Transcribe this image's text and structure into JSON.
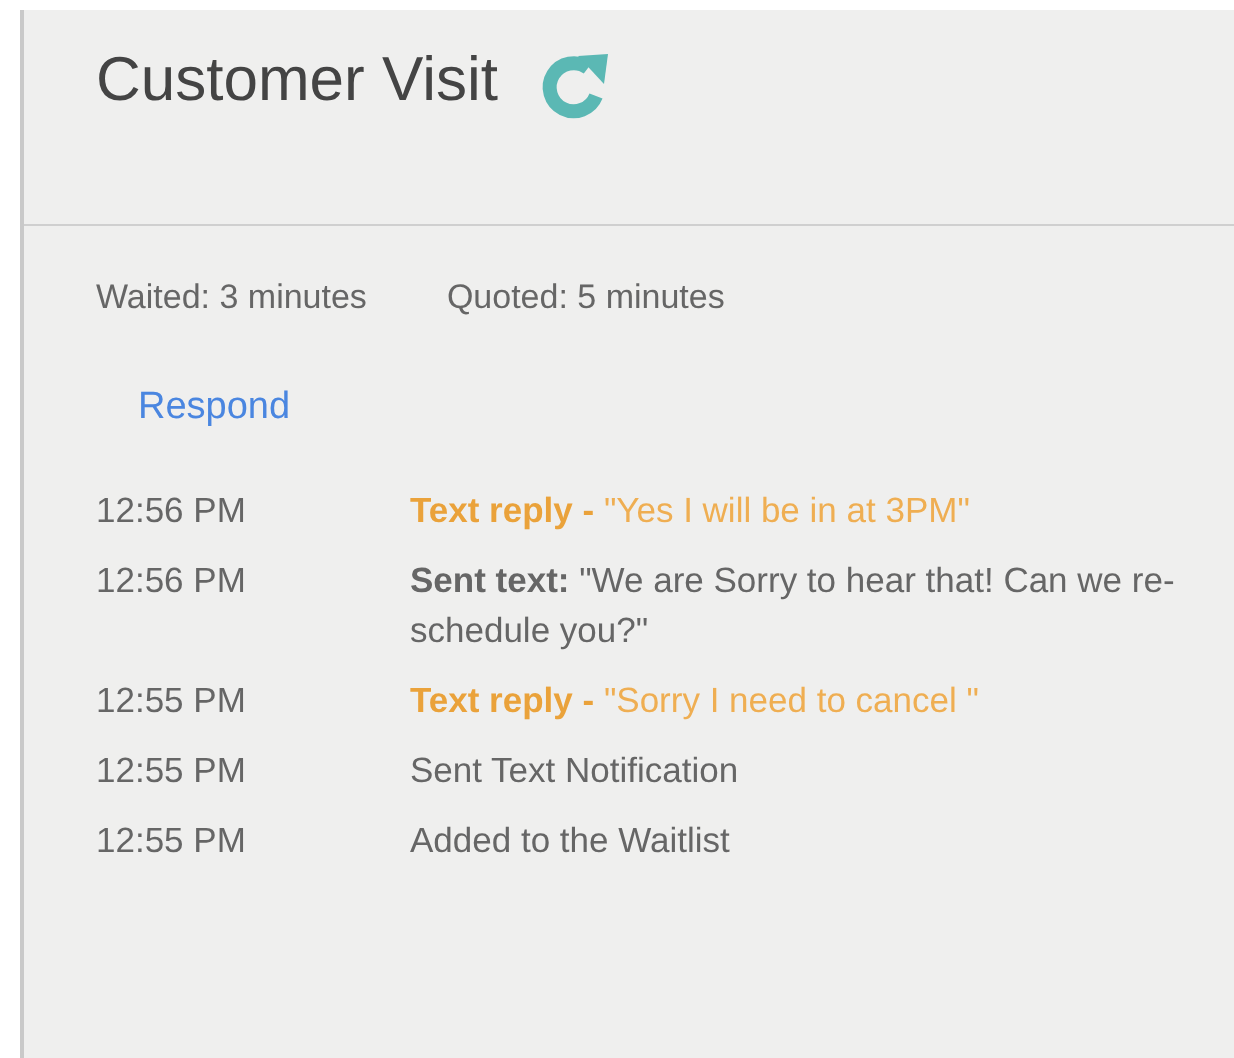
{
  "header": {
    "title": "Customer Visit"
  },
  "stats": [
    "Waited: 3 minutes",
    "Quoted: 5 minutes"
  ],
  "respond_link": "Respond",
  "events": [
    {
      "time": "12:56 PM",
      "kind": "reply",
      "text": "**Text reply -** \"Yes I will be in at 3PM\""
    },
    {
      "time": "12:56 PM",
      "kind": "sent",
      "text": "**Sent text:** \"We are Sorry to hear that! Can we re-schedule you?\""
    },
    {
      "time": "12:55 PM",
      "kind": "reply",
      "text": "**Text reply -** \"Sorry I need to cancel \""
    },
    {
      "time": "12:55 PM",
      "kind": "plain",
      "text": "Sent Text Notification"
    },
    {
      "time": "12:55 PM",
      "kind": "plain",
      "text": "Added to the Waitlist"
    }
  ]
}
